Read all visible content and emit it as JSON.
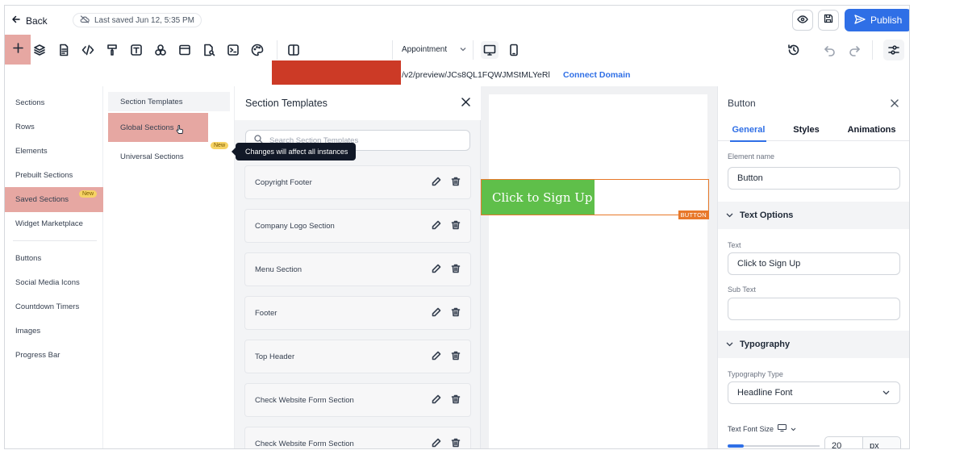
{
  "topbar": {
    "back_label": "Back",
    "saved_status": "Last saved Jun 12, 5:35 PM",
    "publish_label": "Publish"
  },
  "toolbar": {
    "page_select": "Appointment"
  },
  "urlbar": {
    "path": "/v2/preview/JCs8QL1FQWJMStMLYeRl",
    "connect_domain": "Connect Domain"
  },
  "left_panel": {
    "items": [
      {
        "label": "Sections"
      },
      {
        "label": "Rows"
      },
      {
        "label": "Elements"
      },
      {
        "label": "Prebuilt Sections"
      },
      {
        "label": "Saved Sections",
        "badge": "New"
      },
      {
        "label": "Widget Marketplace"
      },
      {
        "label": "Buttons"
      },
      {
        "label": "Social Media Icons"
      },
      {
        "label": "Countdown Timers"
      },
      {
        "label": "Images"
      },
      {
        "label": "Progress Bar"
      }
    ]
  },
  "sub_panel": {
    "items": [
      {
        "label": "Section Templates"
      },
      {
        "label": "Global Sections"
      },
      {
        "label": "Universal Sections",
        "badge": "New"
      }
    ],
    "tooltip": "Changes will affect all instances"
  },
  "templates_panel": {
    "title": "Section Templates",
    "search_placeholder": "Search Section Templates",
    "cards": [
      {
        "label": "Copyright Footer"
      },
      {
        "label": "Company Logo Section"
      },
      {
        "label": "Menu Section"
      },
      {
        "label": "Footer"
      },
      {
        "label": "Top Header"
      },
      {
        "label": "Check Website Form Section"
      },
      {
        "label": "Check Website Form Section"
      }
    ]
  },
  "canvas": {
    "button_text": "Click to Sign Up",
    "element_tag": "BUTTON",
    "button_color": "#5fbf4a",
    "selection_color": "#e8782a"
  },
  "right_panel": {
    "title": "Button",
    "tabs": [
      "General",
      "Styles",
      "Animations"
    ],
    "element_name_label": "Element name",
    "element_name_value": "Button",
    "text_options_label": "Text Options",
    "text_label": "Text",
    "text_value": "Click to Sign Up",
    "sub_text_label": "Sub Text",
    "sub_text_value": "",
    "typography_label": "Typography",
    "typography_type_label": "Typography Type",
    "typography_type_value": "Headline Font",
    "text_font_size_label": "Text Font Size",
    "font_size_value": "20",
    "font_size_unit": "px"
  },
  "colors": {
    "accent": "#2f6fe6",
    "highlight": "#e6a7a2",
    "new_badge": "#f6d365"
  }
}
